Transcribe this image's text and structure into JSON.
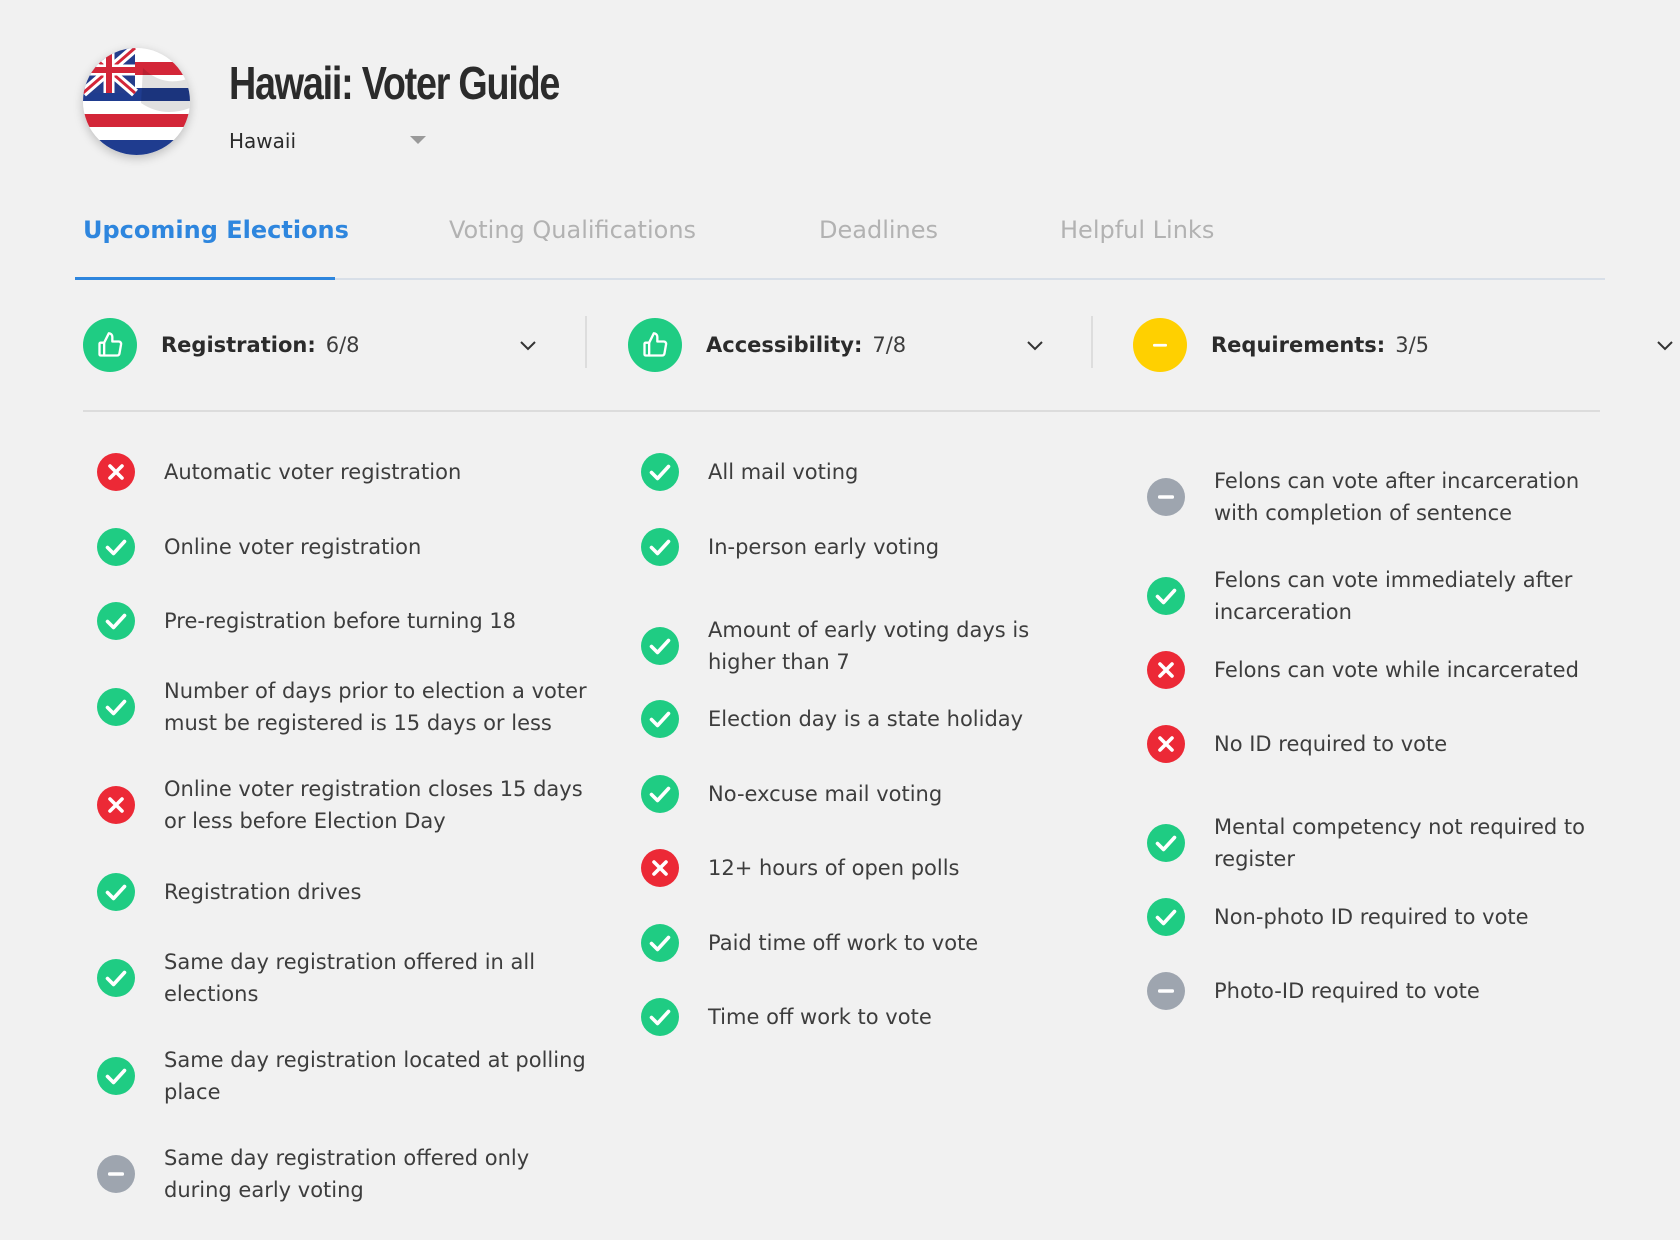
{
  "header": {
    "title": "Hawaii: Voter Guide",
    "state_selected": "Hawaii"
  },
  "tabs": [
    {
      "label": "Upcoming Elections",
      "active": true
    },
    {
      "label": "Voting Qualifications",
      "active": false
    },
    {
      "label": "Deadlines",
      "active": false
    },
    {
      "label": "Helpful Links",
      "active": false
    }
  ],
  "colors": {
    "accent": "#2e86de",
    "pass": "#1fcc83",
    "fail": "#ec2936",
    "neutral": "#9ea5af",
    "warning": "#ffd000"
  },
  "summary": [
    {
      "label": "Registration:",
      "score": "6/8",
      "icon": "thumbs-up-icon",
      "status": "pass"
    },
    {
      "label": "Accessibility:",
      "score": "7/8",
      "icon": "thumbs-up-icon",
      "status": "pass"
    },
    {
      "label": "Requirements:",
      "score": "3/5",
      "icon": "minus-icon",
      "status": "warning"
    }
  ],
  "columns": [
    {
      "items": [
        {
          "text": "Automatic voter registration",
          "status": "fail"
        },
        {
          "text": "Online voter registration",
          "status": "pass"
        },
        {
          "text": "Pre-registration before turning 18",
          "status": "pass"
        },
        {
          "text": "Number of days prior to election a voter must be registered is 15 days or less",
          "status": "pass"
        },
        {
          "text": "Online voter registration closes 15 days or less before Election Day",
          "status": "fail"
        },
        {
          "text": "Registration drives",
          "status": "pass"
        },
        {
          "text": "Same day registration offered in all elections",
          "status": "pass"
        },
        {
          "text": "Same day registration located at polling place",
          "status": "pass"
        },
        {
          "text": "Same day registration offered only during early voting",
          "status": "neutral"
        }
      ]
    },
    {
      "items": [
        {
          "text": "All mail voting",
          "status": "pass"
        },
        {
          "text": "In-person early voting",
          "status": "pass"
        },
        {
          "text": "Amount of early voting days is higher than 7",
          "status": "pass"
        },
        {
          "text": "Election day is a state holiday",
          "status": "pass"
        },
        {
          "text": "No-excuse mail voting",
          "status": "pass"
        },
        {
          "text": "12+ hours of open polls",
          "status": "fail"
        },
        {
          "text": "Paid time off work to vote",
          "status": "pass"
        },
        {
          "text": "Time off work to vote",
          "status": "pass"
        }
      ]
    },
    {
      "items": [
        {
          "text": "Felons can vote after incarceration with completion of sentence",
          "status": "neutral"
        },
        {
          "text": "Felons can vote immediately after incarceration",
          "status": "pass"
        },
        {
          "text": "Felons can vote while incarcerated",
          "status": "fail"
        },
        {
          "text": "No ID required to vote",
          "status": "fail"
        },
        {
          "text": "Mental competency not required to register",
          "status": "pass"
        },
        {
          "text": "Non-photo ID required to vote",
          "status": "pass"
        },
        {
          "text": "Photo-ID required to vote",
          "status": "neutral"
        }
      ]
    }
  ]
}
